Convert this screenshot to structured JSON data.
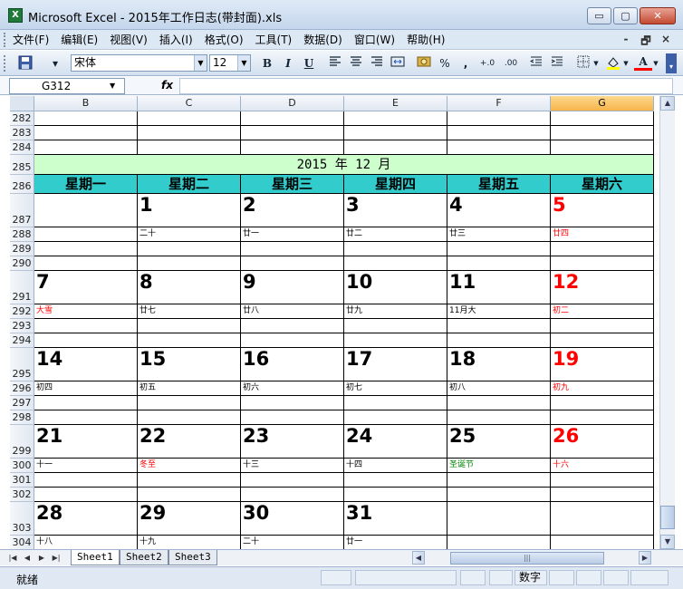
{
  "window": {
    "title": "Microsoft Excel - 2015年工作日志(带封面).xls",
    "app_icon": "X",
    "min_icon": "▭",
    "max_icon": "▢",
    "close_icon": "✕"
  },
  "menu": {
    "items": [
      "文件(F)",
      "编辑(E)",
      "视图(V)",
      "插入(I)",
      "格式(O)",
      "工具(T)",
      "数据(D)",
      "窗口(W)",
      "帮助(H)"
    ],
    "doc_min": "-",
    "doc_restore": "🗗",
    "doc_close": "×"
  },
  "toolbar": {
    "font_name": "宋体",
    "font_size": "12",
    "bold": "B",
    "italic": "I",
    "underline": "U",
    "percent": "%",
    "comma": ",",
    "inc_decimal": "+.0",
    "dec_decimal": ".00",
    "font_color_label": "A"
  },
  "formula_bar": {
    "name_box": "G312",
    "fx": "fx",
    "value": ""
  },
  "sheet": {
    "columns": [
      "B",
      "C",
      "D",
      "E",
      "F",
      "G"
    ],
    "selected_column": "G",
    "rows": [
      "282",
      "283",
      "284",
      "285",
      "286",
      "287",
      "288",
      "289",
      "290",
      "291",
      "292",
      "293",
      "294",
      "295",
      "296",
      "297",
      "298",
      "299",
      "300",
      "301",
      "302",
      "303",
      "304"
    ],
    "month_banner": "2015 年 12 月",
    "weekdays": [
      "星期一",
      "星期二",
      "星期三",
      "星期四",
      "星期五",
      "星期六"
    ],
    "weeks": [
      {
        "days": [
          "",
          "1",
          "2",
          "3",
          "4",
          "5"
        ],
        "lunar": [
          "",
          "二十",
          "廿一",
          "廿二",
          "廿三",
          "廿四"
        ]
      },
      {
        "days": [
          "7",
          "8",
          "9",
          "10",
          "11",
          "12"
        ],
        "lunar": [
          "大雪",
          "廿七",
          "廿八",
          "廿九",
          "11月大",
          "初二"
        ]
      },
      {
        "days": [
          "14",
          "15",
          "16",
          "17",
          "18",
          "19"
        ],
        "lunar": [
          "初四",
          "初五",
          "初六",
          "初七",
          "初八",
          "初九"
        ]
      },
      {
        "days": [
          "21",
          "22",
          "23",
          "24",
          "25",
          "26"
        ],
        "lunar": [
          "十一",
          "冬至",
          "十三",
          "十四",
          "圣诞节",
          "十六"
        ]
      },
      {
        "days": [
          "28",
          "29",
          "30",
          "31",
          "",
          ""
        ],
        "lunar": [
          "十八",
          "十九",
          "二十",
          "廿一",
          "",
          ""
        ]
      }
    ],
    "colors": {
      "weekday_header_bg": "#33cccc",
      "banner_bg": "#ccffcc",
      "holiday_red": "#ff0000",
      "festival_green": "#008000"
    }
  },
  "sheet_tabs": {
    "nav": [
      "|◀",
      "◀",
      "▶",
      "▶|"
    ],
    "tabs": [
      "Sheet1",
      "Sheet2",
      "Sheet3"
    ],
    "active": "Sheet1",
    "hthumb": "|||"
  },
  "status": {
    "ready": "就绪",
    "num": "数字"
  }
}
